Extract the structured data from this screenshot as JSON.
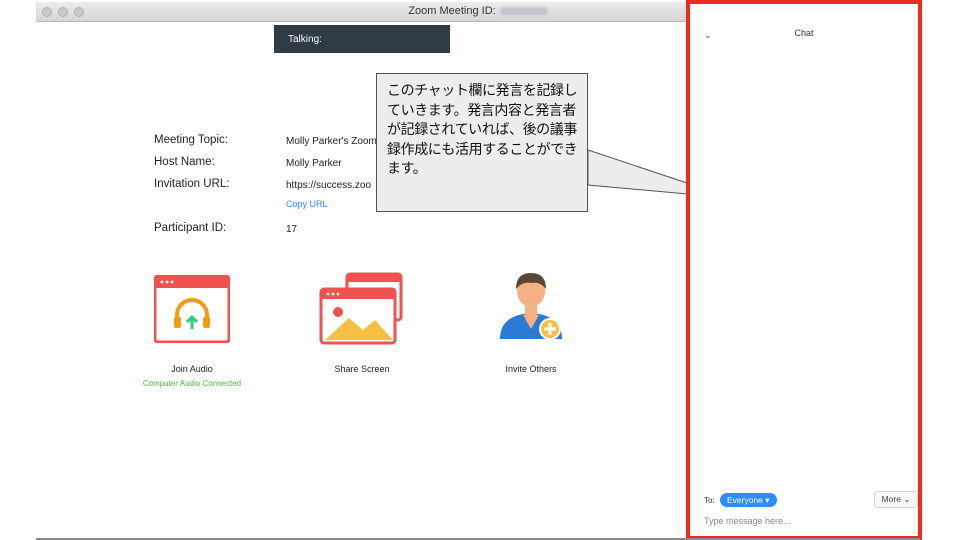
{
  "window": {
    "title": "Zoom Meeting ID:"
  },
  "talking_banner": "Talking:",
  "meeting_info": {
    "topic_label": "Meeting Topic:",
    "topic_value": "Molly Parker's Zoom",
    "host_label": "Host Name:",
    "host_value": "Molly Parker",
    "url_label": "Invitation URL:",
    "url_value": "https://success.zoo",
    "copy_url": "Copy URL",
    "participant_label": "Participant ID:",
    "participant_value": "17"
  },
  "actions": {
    "join_audio": "Join Audio",
    "audio_status": "Computer Audio Connected",
    "share_screen": "Share Screen",
    "invite_others": "Invite Others"
  },
  "callout": {
    "text": "このチャット欄に発言を記録していきます。発言内容と発言者が記録されていれば、後の議事録作成にも活用することができます。"
  },
  "chat": {
    "title": "Chat",
    "to_label": "To:",
    "recipient": "Everyone",
    "more": "More",
    "placeholder": "Type message here..."
  },
  "colors": {
    "chat_border": "#ee2b1e",
    "accent_blue": "#2d8cff",
    "status_green": "#3fc53f",
    "icon_red": "#ef5350",
    "talking_bg": "#2f3b45"
  }
}
